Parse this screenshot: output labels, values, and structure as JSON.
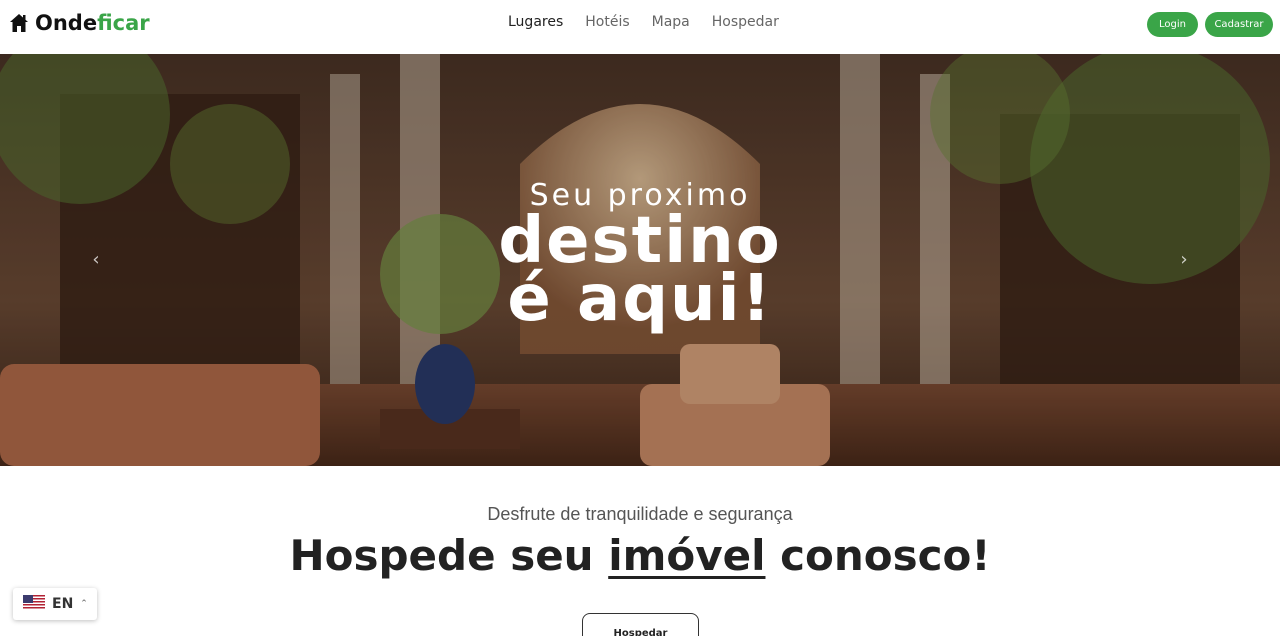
{
  "brand": {
    "name_part1": "Onde",
    "name_part2": "ficar",
    "accent_color": "#3aa548",
    "icon": "house-icon"
  },
  "nav": {
    "items": [
      {
        "label": "Lugares",
        "active": true
      },
      {
        "label": "Hotéis",
        "active": false
      },
      {
        "label": "Mapa",
        "active": false
      },
      {
        "label": "Hospedar",
        "active": false
      }
    ],
    "login_label": "Login",
    "signup_label": "Cadastrar"
  },
  "hero": {
    "kicker": "Seu proximo",
    "line1": "destino",
    "line2": "é aqui!",
    "prev_icon": "chevron-left-icon",
    "next_icon": "chevron-right-icon"
  },
  "section": {
    "subtitle": "Desfrute de tranquilidade e segurança",
    "headline_part1": "Hospede seu ",
    "headline_emphasis": "imóvel",
    "headline_part2": " conosco!",
    "cta_label": "Hospedar"
  },
  "language": {
    "code": "EN",
    "flag_icon": "us-flag-icon",
    "caret_icon": "caret-up-icon"
  }
}
